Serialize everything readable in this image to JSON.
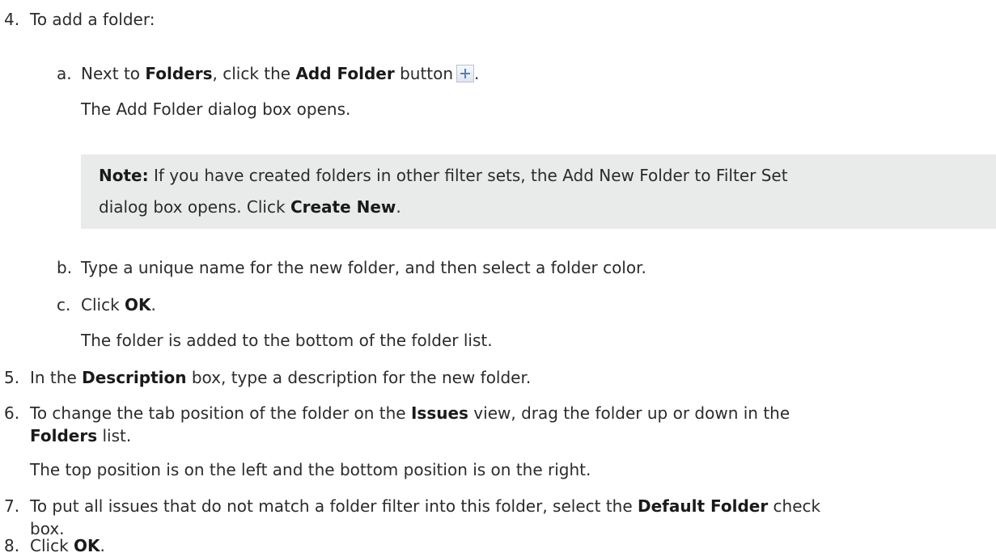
{
  "steps": {
    "s4": {
      "num": "4.",
      "text": "To add a folder:"
    },
    "a": {
      "letter": "a.",
      "t1": "Next to ",
      "b1": "Folders",
      "t2": ", click the ",
      "b2": "Add Folder",
      "t3": " button",
      "icon": "add-folder-icon",
      "t4": ".",
      "result": "The Add Folder dialog box opens."
    },
    "note": {
      "label": "Note:",
      "t1": " If you have created folders in other filter sets, the Add New Folder to Filter Set",
      "t2": "dialog box opens. Click ",
      "b1": "Create New",
      "t3": "."
    },
    "b": {
      "letter": "b.",
      "text": "Type a unique name for the new folder, and then select a folder color."
    },
    "c": {
      "letter": "c.",
      "t1": "Click ",
      "b1": "OK",
      "t2": ".",
      "result": "The folder is added to the bottom of the folder list."
    },
    "s5": {
      "num": "5.",
      "t1": "In the ",
      "b1": "Description",
      "t2": " box, type a description for the new folder."
    },
    "s6": {
      "num": "6.",
      "t1": "To change the tab position of the folder on the ",
      "b1": "Issues",
      "t2": " view, drag the folder up or down in the",
      "b2": "Folders",
      "t3": " list.",
      "result": "The top position is on the left and the bottom position is on the right."
    },
    "s7": {
      "num": "7.",
      "t1": "To put all issues that do not match a folder filter into this folder, select the ",
      "b1": "Default Folder",
      "t2": " check",
      "t3": "box."
    },
    "s8": {
      "num": "8.",
      "t1": "Click ",
      "b1": "OK",
      "t2": "."
    }
  },
  "colors": {
    "text": "#2b2b2b",
    "note_background": "#e9ebeb"
  }
}
